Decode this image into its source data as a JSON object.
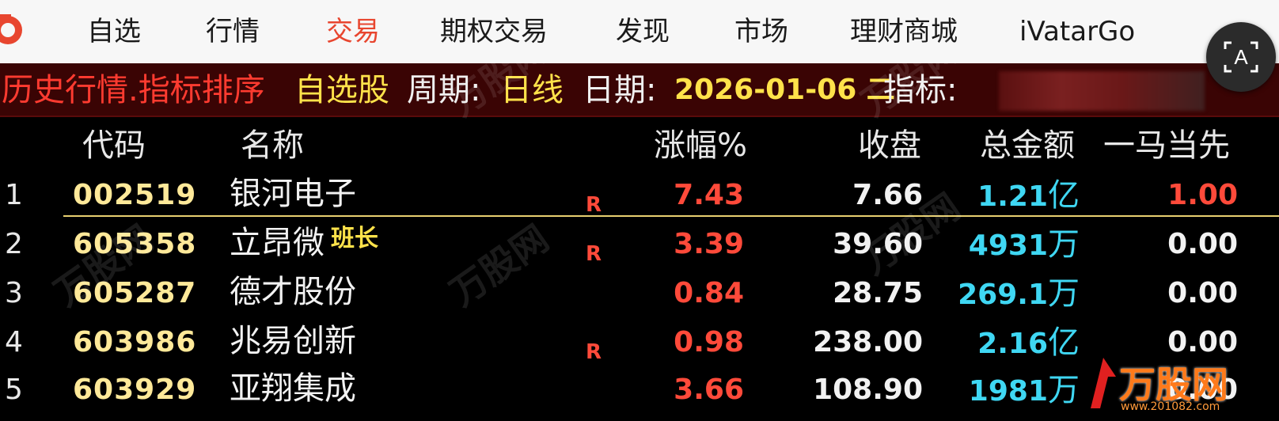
{
  "nav": {
    "items": [
      {
        "label": "自选",
        "active": false
      },
      {
        "label": "行情",
        "active": false
      },
      {
        "label": "交易",
        "active": true
      },
      {
        "label": "期权交易",
        "active": false
      },
      {
        "label": "发现",
        "active": false
      },
      {
        "label": "市场",
        "active": false
      },
      {
        "label": "理财商城",
        "active": false
      },
      {
        "label": "iVatarGo",
        "active": false
      }
    ],
    "scan_icon": "scan-text-icon"
  },
  "infobar": {
    "title": "历史行情.指标排序",
    "list": "自选股",
    "period_label": "周期:",
    "period_value": "日线",
    "date_label": "日期:",
    "date_value": "2026-01-06 二",
    "indicator_label": "指标:"
  },
  "table": {
    "headers": {
      "code": "代码",
      "name": "名称",
      "pct": "涨幅%",
      "close": "收盘",
      "amount": "总金额",
      "extra": "一马当先"
    },
    "rows": [
      {
        "idx": "1",
        "code": "002519",
        "name": "银河电子",
        "tag": "R",
        "pct": "7.43",
        "close": "7.66",
        "amount": "1.21",
        "unit": "亿",
        "extra": "1.00"
      },
      {
        "idx": "2",
        "code": "605358",
        "name": "立昂微",
        "tag": "R",
        "pct": "3.39",
        "close": "39.60",
        "amount": "4931",
        "unit": "万",
        "extra": "0.00"
      },
      {
        "idx": "3",
        "code": "605287",
        "name": "德才股份",
        "tag": "",
        "pct": "0.84",
        "close": "28.75",
        "amount": "269.1",
        "unit": "万",
        "extra": "0.00"
      },
      {
        "idx": "4",
        "code": "603986",
        "name": "兆易创新",
        "tag": "R",
        "pct": "0.98",
        "close": "238.00",
        "amount": "2.16",
        "unit": "亿",
        "extra": "0.00"
      },
      {
        "idx": "5",
        "code": "603929",
        "name": "亚翔集成",
        "tag": "",
        "pct": "3.66",
        "close": "108.90",
        "amount": "1981",
        "unit": "万",
        "extra": "0.00"
      }
    ],
    "badge": "班长"
  },
  "watermark": {
    "text": "万股网",
    "url": "www.201082.com"
  },
  "colors": {
    "red": "#ff3b30",
    "yellow": "#ffe24a",
    "cyan": "#3fd7f3",
    "infobar_bg": "#3a0404"
  }
}
